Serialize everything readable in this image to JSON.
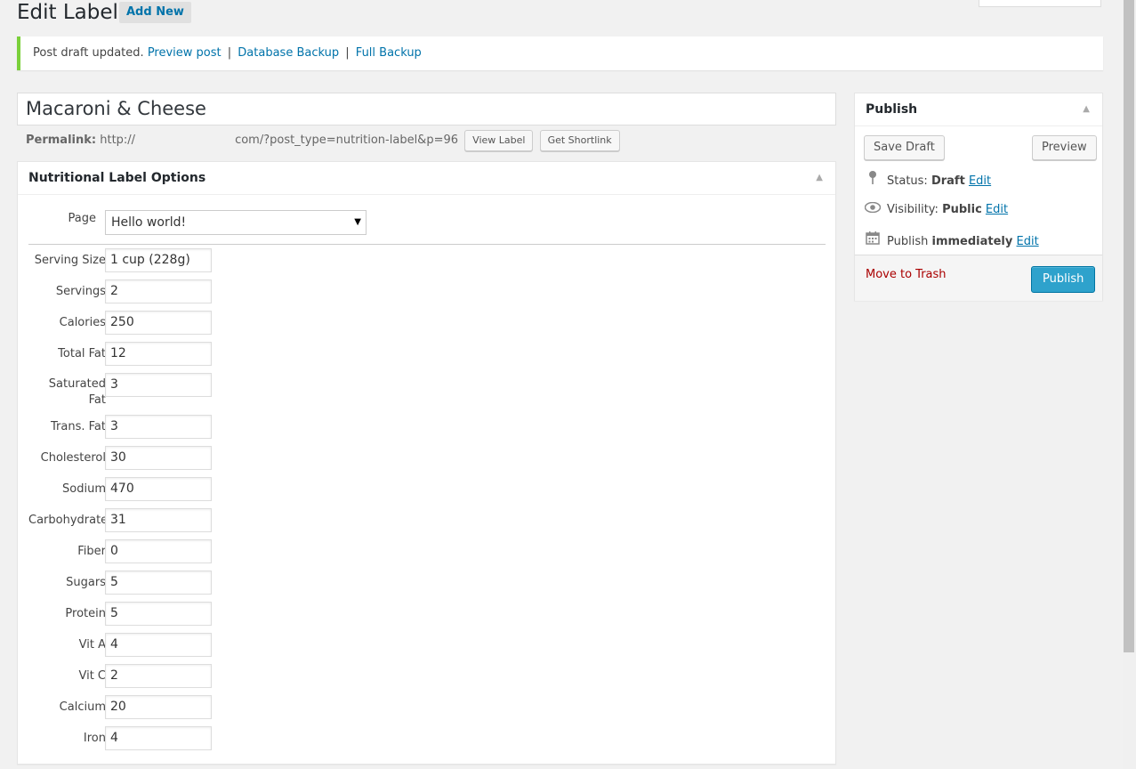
{
  "header": {
    "title": "Edit Label",
    "add_new": "Add New"
  },
  "notice": {
    "text": "Post draft updated.",
    "preview_link": "Preview post",
    "sep": "|",
    "backup_link": "Database Backup",
    "full_backup_link": "Full Backup"
  },
  "post": {
    "title": "Macaroni & Cheese",
    "permalink_label": "Permalink:",
    "permalink_start": "http://",
    "permalink_end": "com/?post_type=nutrition-label&p=96",
    "view_label": "View Label",
    "get_shortlink": "Get Shortlink"
  },
  "options": {
    "title": "Nutritional Label Options",
    "page_label": "Page",
    "page_value": "Hello world!",
    "fields": [
      {
        "label": "Serving Size",
        "value": "1 cup (228g)"
      },
      {
        "label": "Servings",
        "value": "2"
      },
      {
        "label": "Calories",
        "value": "250"
      },
      {
        "label": "Total Fat",
        "value": "12"
      },
      {
        "label": "Saturated Fat",
        "value": "3"
      },
      {
        "label": "Trans. Fat",
        "value": "3"
      },
      {
        "label": "Cholesterol",
        "value": "30"
      },
      {
        "label": "Sodium",
        "value": "470"
      },
      {
        "label": "Carbohydrates",
        "value": "31"
      },
      {
        "label": "Fiber",
        "value": "0"
      },
      {
        "label": "Sugars",
        "value": "5"
      },
      {
        "label": "Protein",
        "value": "5"
      },
      {
        "label": "Vit A",
        "value": "4"
      },
      {
        "label": "Vit C",
        "value": "2"
      },
      {
        "label": "Calcium",
        "value": "20"
      },
      {
        "label": "Iron",
        "value": "4"
      }
    ]
  },
  "publish": {
    "title": "Publish",
    "save_draft": "Save Draft",
    "preview": "Preview",
    "status_label": "Status:",
    "status_value": "Draft",
    "visibility_label": "Visibility:",
    "visibility_value": "Public",
    "publish_label": "Publish",
    "publish_value": "immediately",
    "edit": "Edit",
    "move_to_trash": "Move to Trash",
    "publish_button": "Publish"
  },
  "icons": {
    "pin": "pushpin-icon",
    "eye": "eye-icon",
    "calendar": "calendar-icon",
    "toggle": "triangle-up-icon",
    "select_arrow": "triangle-down-icon"
  },
  "colors": {
    "accent": "#0073aa",
    "notice_border": "#7ad03a",
    "publish_button": "#2ea2cc",
    "trash": "#aa0000"
  }
}
